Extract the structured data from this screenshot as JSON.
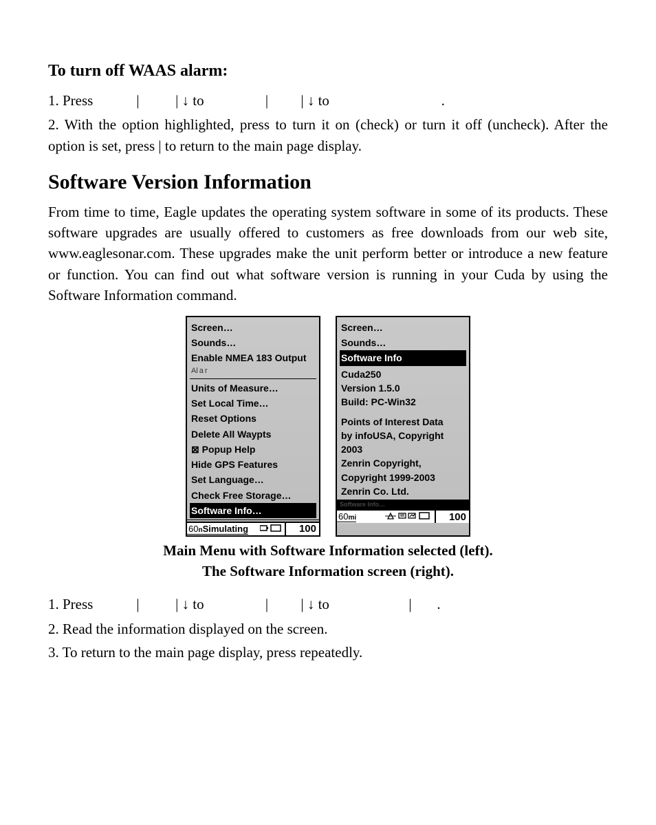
{
  "waas_heading": "To turn off WAAS alarm:",
  "waas_step1_a": "1. Press ",
  "waas_step1_b": "|",
  "waas_step1_c": "|",
  "waas_step1_d": " to ",
  "waas_step1_e": "|",
  "waas_step1_f": "|",
  "waas_step1_g": " to ",
  "waas_step1_h": ".",
  "waas_step2": "2. With the option highlighted, press        to turn it on (check) or turn it off (uncheck). After the option is set, press       |        to return to the main page display.",
  "sv_heading": "Software Version Information",
  "sv_para": "From time to time, Eagle updates the operating system software in some of its products. These software upgrades are usually offered to customers as free downloads from our web site, www.eaglesonar.com. These upgrades make the unit perform better or introduce a new feature or function. You can find out what software version is running in your Cuda by using the Software Information command.",
  "caption_line1": "Main Menu with Software Information selected (left).",
  "caption_line2": "The Software Information screen (right).",
  "sv_step1_a": "1. Press ",
  "sv_step1_b": "|",
  "sv_step1_c": "|",
  "sv_step1_d": " to ",
  "sv_step1_e": "|",
  "sv_step1_f": "|",
  "sv_step1_g": " to ",
  "sv_step1_h": "|",
  "sv_step1_i": ".",
  "sv_step2": "2. Read the information displayed on the screen.",
  "sv_step3": "3. To return to the main page display, press         repeatedly.",
  "screen_left": {
    "items": [
      "Screen…",
      "Sounds…",
      "Enable NMEA 183 Output",
      "Units of Measure…",
      "Set Local Time…",
      "Reset Options",
      "Delete All Waypts",
      "⊠ Popup Help",
      "Hide GPS Features",
      "Set Language…",
      "Check Free Storage…",
      "Software Info…"
    ],
    "partial_cut": "Alarms",
    "status_left_prefix": "60",
    "status_left_text": "Simulating",
    "status_right": "100"
  },
  "screen_right": {
    "top_items": [
      "Screen…",
      "Sounds…"
    ],
    "selected": "Software Info",
    "info": [
      "Cuda250",
      "Version 1.5.0",
      "Build: PC-Win32"
    ],
    "info2": [
      "Points of Interest Data",
      "by infoUSA, Copyright",
      "2003",
      "Zenrin Copyright,",
      "Copyright 1999-2003",
      "Zenrin Co. Ltd."
    ],
    "bottom_cut": "Software Info…",
    "status_left_prefix": "60",
    "status_left_unit": "mi",
    "status_right": "100"
  }
}
